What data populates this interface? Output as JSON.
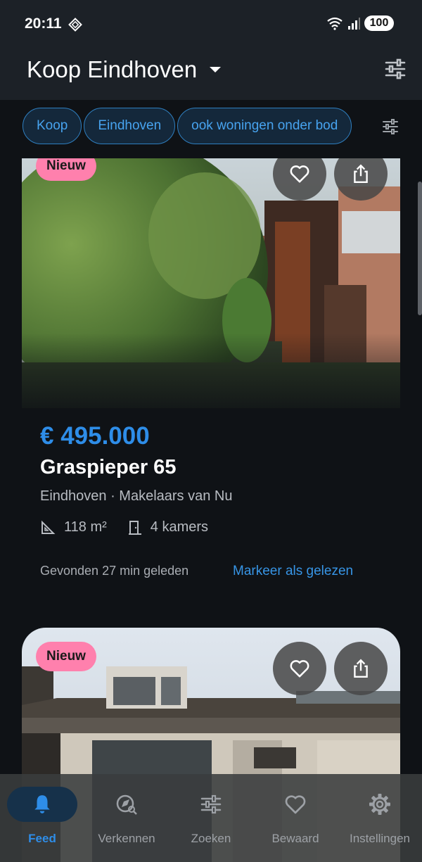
{
  "status": {
    "time": "20:11",
    "battery": "100",
    "network": "5"
  },
  "appbar": {
    "title": "Koop Eindhoven"
  },
  "filters": {
    "chips": [
      "Koop",
      "Eindhoven",
      "ook woningen onder bod"
    ]
  },
  "listings": [
    {
      "badge": "Nieuw",
      "price": "€ 495.000",
      "address": "Graspieper 65",
      "location": "Eindhoven · Makelaars van Nu",
      "area": "118 m²",
      "rooms": "4 kamers",
      "found": "Gevonden 27 min geleden",
      "mark_read": "Markeer als gelezen"
    },
    {
      "badge": "Nieuw"
    }
  ],
  "nav": {
    "items": [
      {
        "label": "Feed",
        "icon": "bell-icon",
        "active": true
      },
      {
        "label": "Verkennen",
        "icon": "explore-icon"
      },
      {
        "label": "Zoeken",
        "icon": "tune-icon"
      },
      {
        "label": "Bewaard",
        "icon": "heart-icon"
      },
      {
        "label": "Instellingen",
        "icon": "gear-icon"
      }
    ]
  },
  "colors": {
    "accent": "#2e8de8",
    "badge": "#ff80ad",
    "chip_border": "#2f7fc0",
    "background": "#0f1216"
  }
}
